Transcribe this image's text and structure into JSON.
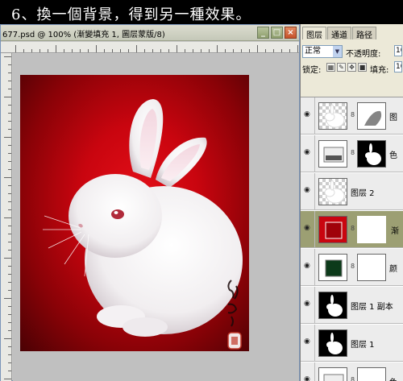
{
  "caption": "6、換一個背景，得到另一種效果。",
  "document": {
    "title": "677.psd @ 100% (漸變填充 1, 圖层蒙版/8)",
    "minimize": "_",
    "maximize": "□",
    "close": "×"
  },
  "layers_panel": {
    "tabs": [
      "图层",
      "通道",
      "路径"
    ],
    "blend_mode": "正常",
    "opacity_label": "不透明度:",
    "opacity_value": "10",
    "lock_label": "锁定:",
    "fill_label": "填充:",
    "fill_value": "10",
    "layers": [
      {
        "name": "图",
        "visible": true,
        "selected": false
      },
      {
        "name": "色",
        "visible": true,
        "selected": false
      },
      {
        "name": "图层 2",
        "visible": true,
        "selected": false
      },
      {
        "name": "渐",
        "visible": true,
        "selected": true
      },
      {
        "name": "颜",
        "visible": true,
        "selected": false
      },
      {
        "name": "图层 1 副本",
        "visible": true,
        "selected": false
      },
      {
        "name": "图层 1",
        "visible": true,
        "selected": false
      },
      {
        "name": "色",
        "visible": true,
        "selected": false
      }
    ]
  },
  "colors": {
    "canvas_red": "#c9050f",
    "selected_layer": "#9c9f73",
    "panel_bg": "#ece9d8"
  }
}
